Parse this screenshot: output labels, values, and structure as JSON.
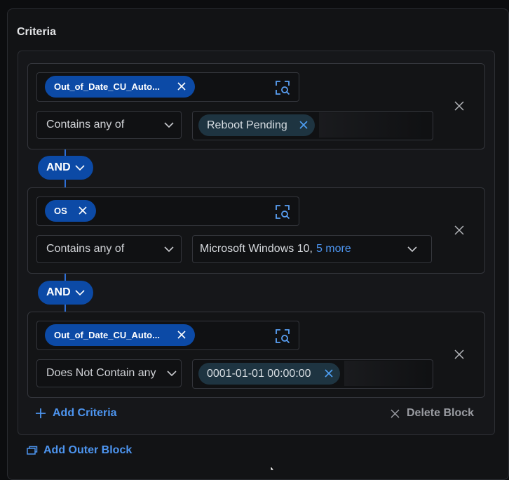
{
  "title": "Criteria",
  "blocks": [
    {
      "field": "Out_of_Date_CU_Auto...",
      "operator": "Contains any of",
      "values": [
        "Reboot Pending"
      ]
    },
    {
      "field": "OS",
      "operator": "Contains any of",
      "value_text": "Microsoft Windows 10,",
      "value_more": "5 more"
    },
    {
      "field": "Out_of_Date_CU_Auto...",
      "operator": "Does Not Contain any",
      "values": [
        "0001-01-01 00:00:00"
      ]
    }
  ],
  "connectors": [
    "AND",
    "AND"
  ],
  "actions": {
    "add_criteria": "Add Criteria",
    "delete_block": "Delete Block",
    "add_outer_block": "Add Outer Block"
  },
  "icons": {
    "remove": "close-icon",
    "field_picker": "field-search-icon",
    "dropdown": "chevron-down-icon",
    "add": "plus-icon",
    "outer_block": "layers-icon"
  },
  "colors": {
    "accent": "#0c4aa6",
    "link": "#4d95f0",
    "value_chip": "#1e3441",
    "background": "#0c0d0f"
  }
}
